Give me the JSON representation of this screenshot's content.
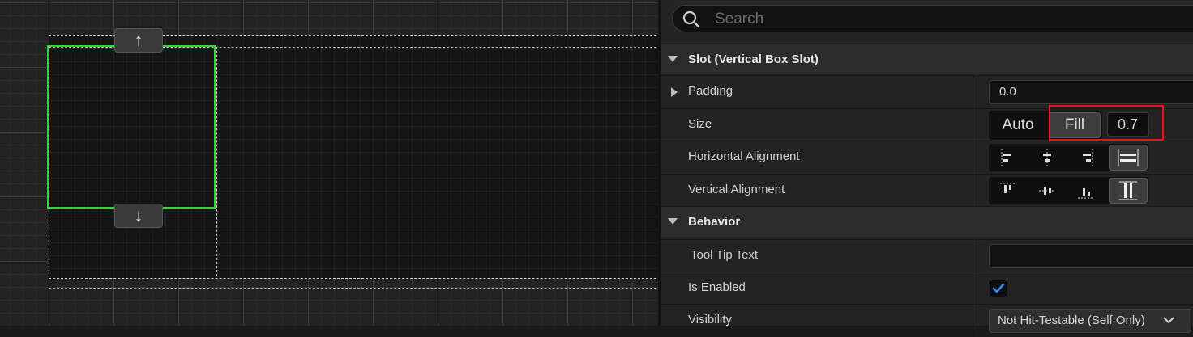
{
  "canvas": {
    "move_up_label": "↑",
    "move_down_label": "↓",
    "selection_color": "#3ad23a"
  },
  "details": {
    "search_placeholder": "Search",
    "sections": {
      "slot": "Slot (Vertical Box Slot)",
      "behavior": "Behavior"
    },
    "rows": {
      "padding": {
        "label": "Padding",
        "value": "0.0"
      },
      "size": {
        "label": "Size",
        "options": [
          "Auto",
          "Fill"
        ],
        "selected": "Fill",
        "fill_value": "0.7"
      },
      "horizontal_alignment": {
        "label": "Horizontal Alignment",
        "options": [
          "left-align-icon",
          "center-align-icon",
          "right-align-icon",
          "fill-align-icon"
        ],
        "selected": "fill-align-icon"
      },
      "vertical_alignment": {
        "label": "Vertical Alignment",
        "options": [
          "top-align-icon",
          "center-align-icon",
          "bottom-align-icon",
          "fill-align-icon"
        ],
        "selected": "fill-align-icon"
      },
      "tooltip": {
        "label": "Tool Tip Text",
        "value": ""
      },
      "is_enabled": {
        "label": "Is Enabled",
        "checked": true
      },
      "visibility": {
        "label": "Visibility",
        "value": "Not Hit-Testable (Self Only)"
      }
    },
    "highlight_color": "#e5161c",
    "check_color": "#2f8ef2"
  }
}
